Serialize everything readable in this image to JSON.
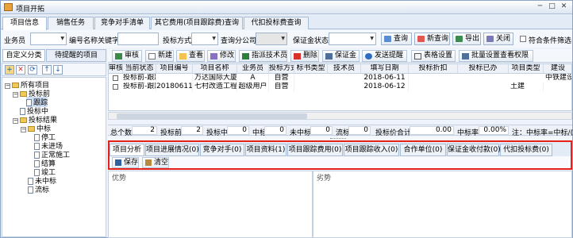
{
  "window": {
    "title": "项目开拓"
  },
  "tabs": [
    {
      "label": "项目信息",
      "active": true
    },
    {
      "label": "销售任务"
    },
    {
      "label": "竞争对手清单"
    },
    {
      "label": "其它费用(项目跟踪费)查询"
    },
    {
      "label": "代扣投标费查询"
    }
  ],
  "filter": {
    "salesperson_label": "业务员",
    "keyword_label": "编号名称关键字",
    "bid_method_label": "投标方式",
    "query_company_label": "查询分公司",
    "deposit_status_label": "保证金状态",
    "query_button": "查询",
    "new_query_button": "新查询",
    "export_button": "导出",
    "close_button": "关闭",
    "match_all_label": "符合条件筛选"
  },
  "left": {
    "tabs": [
      "自定义分类",
      "待提醒的项目"
    ],
    "tool_icons": [
      "folder-add-icon",
      "delete-icon",
      "refresh-icon",
      "up-icon",
      "down-icon"
    ],
    "tree": [
      {
        "label": "所有项目"
      },
      {
        "label": "投标前"
      },
      {
        "label": "跟踪"
      },
      {
        "label": "投标中"
      },
      {
        "label": "投标结果"
      },
      {
        "label": "中标"
      },
      {
        "label": "停工"
      },
      {
        "label": "未进场"
      },
      {
        "label": "正常施工"
      },
      {
        "label": "结算"
      },
      {
        "label": "竣工"
      },
      {
        "label": "未中标"
      },
      {
        "label": "流标"
      }
    ]
  },
  "toolbar": {
    "buttons": [
      "审核",
      "新建",
      "查看",
      "修改",
      "指派技术员",
      "删除",
      "保证金",
      "发送提醒",
      "表格设置",
      "批量设置查看权限"
    ]
  },
  "grid": {
    "headers": [
      "审核",
      "当前状态",
      "项目编号",
      "项目名称",
      "业务员",
      "投标方式",
      "标书类型",
      "技术员",
      "填写日期",
      "投标折扣",
      "投标已办",
      "项目类型",
      "建设"
    ],
    "rows": [
      [
        "",
        "投标前-跟踪",
        "",
        "万达国际大厦",
        "A",
        "自营",
        "",
        "",
        "2018-06-11",
        "",
        "",
        "",
        "中铁建设"
      ],
      [
        "",
        "投标前-跟踪",
        "20180611001",
        "七村改造工程",
        "超级用户",
        "自营",
        "",
        "",
        "2018-06-12",
        "",
        "",
        "土建",
        ""
      ]
    ]
  },
  "summary": {
    "total_label": "总个数",
    "total": "2",
    "before_label": "投标前",
    "before": "2",
    "during_label": "投标中",
    "during": "0",
    "won_label": "中标",
    "won": "0",
    "lost_label": "未中标",
    "lost": "0",
    "void_label": "流标",
    "void": "0",
    "sum_label": "投标价合计",
    "sum": "0.00",
    "rate_label": "中标率",
    "rate": "0.00%",
    "formula": "注：中标率=中标/(中标+"
  },
  "bottom": {
    "tabs": [
      {
        "label": "项目分析",
        "active": true
      },
      {
        "label": "项目进展情况(0)"
      },
      {
        "label": "竞争对手(0)"
      },
      {
        "label": "项目资料(1)"
      },
      {
        "label": "项目跟踪费用(0)"
      },
      {
        "label": "项目跟踪收入(0)"
      },
      {
        "label": "合作单位(0)"
      },
      {
        "label": "保证金收付款(0)"
      },
      {
        "label": "代扣投标费(0)"
      }
    ],
    "save_button": "保存",
    "clear_button": "清空",
    "advantage_label": "优势",
    "disadvantage_label": "劣势"
  }
}
